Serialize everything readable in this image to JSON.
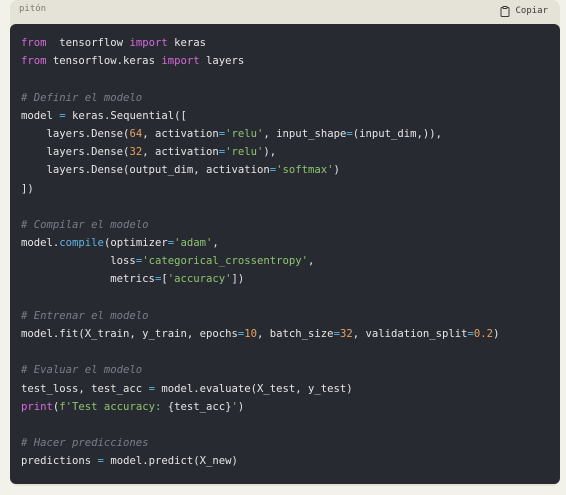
{
  "header": {
    "language": "pitón",
    "copy_label": "Copiar"
  },
  "code_lines": [
    [
      [
        "kw",
        "from"
      ],
      [
        "",
        "  tensorflow "
      ],
      [
        "kw",
        "import"
      ],
      [
        "",
        " keras"
      ]
    ],
    [
      [
        "kw",
        "from"
      ],
      [
        "",
        " tensorflow.keras "
      ],
      [
        "kw",
        "import"
      ],
      [
        "",
        " layers"
      ]
    ],
    [],
    [
      [
        "cm",
        "# Definir el modelo"
      ]
    ],
    [
      [
        "",
        "model "
      ],
      [
        "op",
        "="
      ],
      [
        "",
        " keras.Sequential(["
      ]
    ],
    [
      [
        "",
        "    layers.Dense("
      ],
      [
        "num",
        "64"
      ],
      [
        "",
        ", activation"
      ],
      [
        "op",
        "="
      ],
      [
        "str",
        "'relu'"
      ],
      [
        "",
        ", input_shape"
      ],
      [
        "op",
        "="
      ],
      [
        "",
        "(input_dim,)),"
      ]
    ],
    [
      [
        "",
        "    layers.Dense("
      ],
      [
        "num",
        "32"
      ],
      [
        "",
        ", activation"
      ],
      [
        "op",
        "="
      ],
      [
        "str",
        "'relu'"
      ],
      [
        "",
        "),"
      ]
    ],
    [
      [
        "",
        "    layers.Dense(output_dim, activation"
      ],
      [
        "op",
        "="
      ],
      [
        "str",
        "'softmax'"
      ],
      [
        "",
        ")"
      ]
    ],
    [
      [
        "",
        "])"
      ]
    ],
    [],
    [
      [
        "cm",
        "# Compilar el modelo"
      ]
    ],
    [
      [
        "",
        "model."
      ],
      [
        "fn",
        "compile"
      ],
      [
        "",
        "(optimizer"
      ],
      [
        "op",
        "="
      ],
      [
        "str",
        "'adam'"
      ],
      [
        "",
        ","
      ]
    ],
    [
      [
        "",
        "              loss"
      ],
      [
        "op",
        "="
      ],
      [
        "str",
        "'categorical_crossentropy'"
      ],
      [
        "",
        ","
      ]
    ],
    [
      [
        "",
        "              metrics"
      ],
      [
        "op",
        "="
      ],
      [
        "",
        "["
      ],
      [
        "str",
        "'accuracy'"
      ],
      [
        "",
        "])"
      ]
    ],
    [],
    [
      [
        "cm",
        "# Entrenar el modelo"
      ]
    ],
    [
      [
        "",
        "model.fit(X_train, y_train, epochs"
      ],
      [
        "op",
        "="
      ],
      [
        "num",
        "10"
      ],
      [
        "",
        ", batch_size"
      ],
      [
        "op",
        "="
      ],
      [
        "num",
        "32"
      ],
      [
        "",
        ", validation_split"
      ],
      [
        "op",
        "="
      ],
      [
        "num",
        "0.2"
      ],
      [
        "",
        ")"
      ]
    ],
    [],
    [
      [
        "cm",
        "# Evaluar el modelo"
      ]
    ],
    [
      [
        "",
        "test_loss, test_acc "
      ],
      [
        "op",
        "="
      ],
      [
        "",
        " model.evaluate(X_test, y_test)"
      ]
    ],
    [
      [
        "kw",
        "print"
      ],
      [
        "",
        "("
      ],
      [
        "str",
        "f'Test accuracy: "
      ],
      [
        "",
        "{test_acc}"
      ],
      [
        "str",
        "'"
      ],
      [
        "",
        ")"
      ]
    ],
    [],
    [
      [
        "cm",
        "# Hacer predicciones"
      ]
    ],
    [
      [
        "",
        "predictions "
      ],
      [
        "op",
        "="
      ],
      [
        "",
        " model.predict(X_new)"
      ]
    ]
  ]
}
